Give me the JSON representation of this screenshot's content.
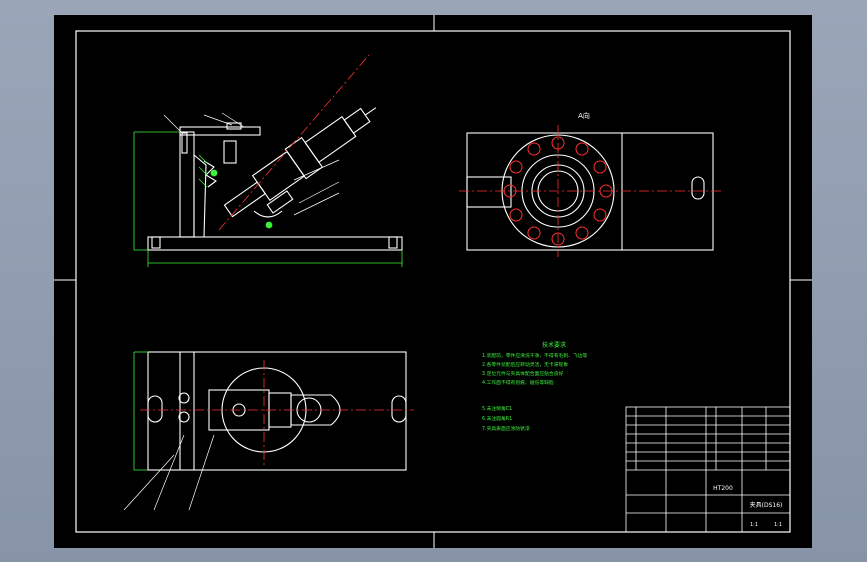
{
  "sheet": {
    "view_label": "A向",
    "tech_title": "技术要求",
    "tech_lines": [
      "1.装配前，零件应清洗干净，不得有毛刺、飞边等",
      "2.各零件装配后应转动灵活，无卡滞现象",
      "3.定位元件与夹具体配合面应贴合良好",
      "4.工作面不得有划痕、碰伤等缺陷",
      "5.未注倒角C1",
      "6.未注圆角R1",
      "7.夹具表面应涂防锈漆"
    ],
    "title_block": {
      "part_name": "夹具(DS16)",
      "material": "HT200",
      "scale": "1:1",
      "sheet_no": "1:1"
    }
  },
  "colors": {
    "background": "#000000",
    "lines": "#ffffff",
    "dimensions": "#3cf03c",
    "center_lines": "#ff3030",
    "window_frame": "#8794a8"
  }
}
